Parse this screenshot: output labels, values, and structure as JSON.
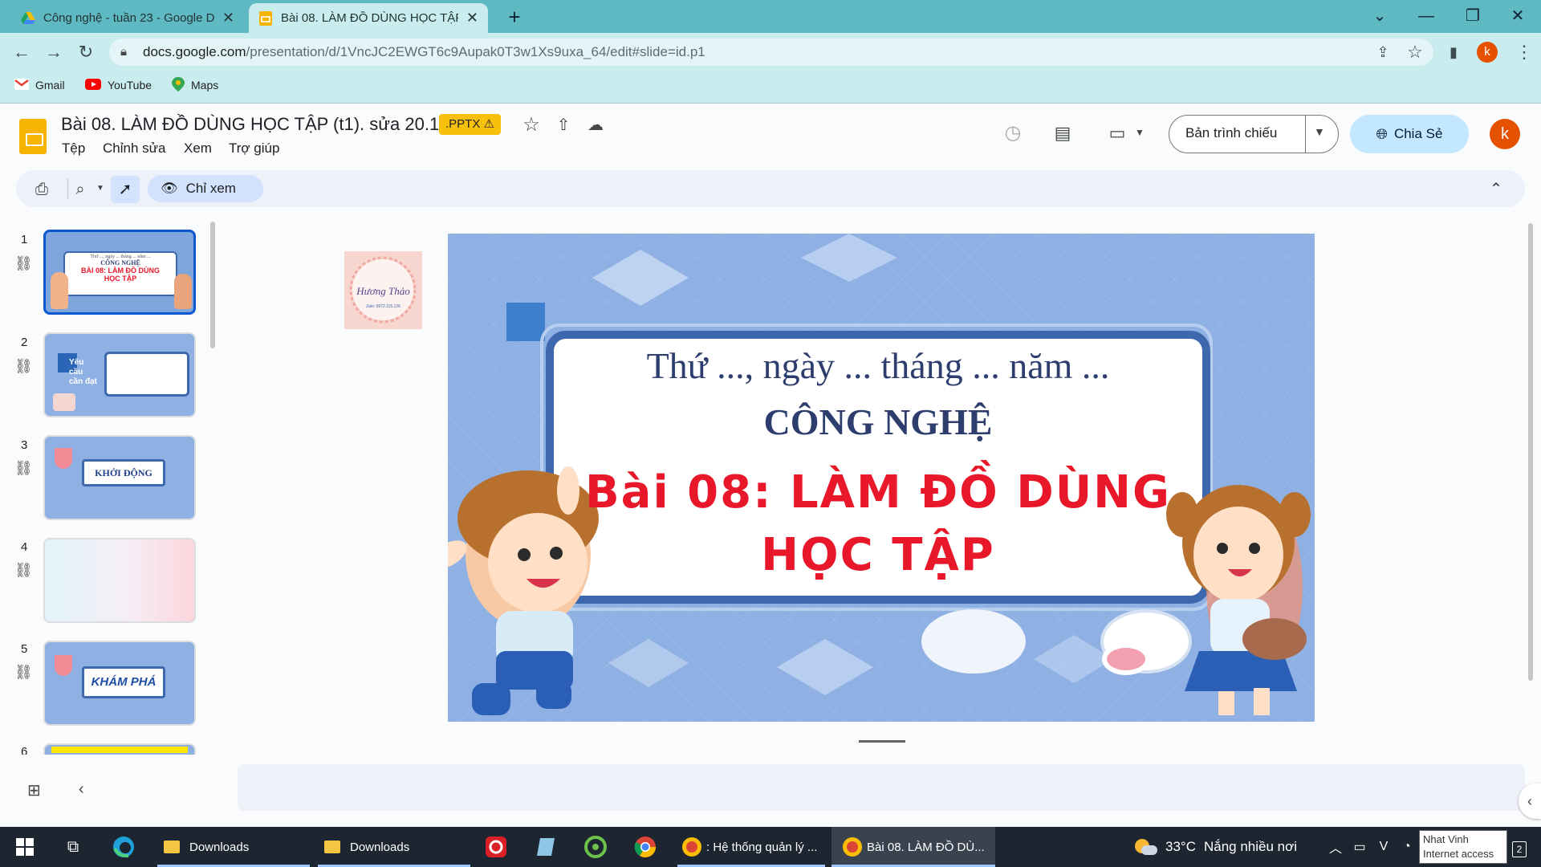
{
  "browser": {
    "tabs": [
      {
        "title": "Công nghệ - tuần 23 - Google Dr",
        "icon": "google-drive-icon",
        "active": false
      },
      {
        "title": "Bài 08. LÀM ĐỒ DÙNG HỌC TẬP",
        "icon": "google-slides-icon",
        "active": true
      }
    ],
    "url_host": "docs.google.com",
    "url_path": "/presentation/d/1VncJC2EWGT6c9Aupak0T3w1Xs9uxa_64/edit#slide=id.p1",
    "bookmarks": [
      {
        "label": "Gmail",
        "icon": "gmail-icon"
      },
      {
        "label": "YouTube",
        "icon": "youtube-icon"
      },
      {
        "label": "Maps",
        "icon": "maps-icon"
      }
    ],
    "profile_initial": "k"
  },
  "header": {
    "title": "Bài 08. LÀM ĐỒ DÙNG HỌC TẬP (t1). sửa 20.1",
    "badge": ".PPTX ⚠",
    "menus": [
      "Tệp",
      "Chỉnh sửa",
      "Xem",
      "Trợ giúp"
    ],
    "present_label": "Bản trình chiếu",
    "share_label": "Chia Sẻ",
    "avatar_initial": "k"
  },
  "toolbar": {
    "view_mode_label": "Chỉ xem"
  },
  "filmstrip": {
    "slides": [
      {
        "number": "1",
        "text": [
          "Thứ ..., ngày ... tháng ... năm ...",
          "CÔNG NGHỆ",
          "BÀI 08: LÀM ĐỒ DÙNG",
          "HỌC TẬP"
        ]
      },
      {
        "number": "2",
        "text": [
          "Yêu",
          "cầu",
          "cần đạt"
        ]
      },
      {
        "number": "3",
        "text": [
          "KHỞI ĐỘNG"
        ]
      },
      {
        "number": "4",
        "text": []
      },
      {
        "number": "5",
        "text": [
          "KHÁM PHÁ"
        ]
      },
      {
        "number": "6",
        "text": []
      }
    ]
  },
  "slide": {
    "date_line": "Thứ ..., ngày ... tháng ... năm ...",
    "subject": "CÔNG NGHỆ",
    "lesson_line1": "Bài 08: LÀM ĐỒ DÙNG",
    "lesson_line2": "HỌC TẬP",
    "stamp_name": "Hương Thảo",
    "stamp_sub": "Zalo: 0972.115.126",
    "colors": {
      "background": "#8fb0e3",
      "frame": "#3e68ad",
      "title": "#2d3e6e",
      "lesson": "#e8182a"
    }
  },
  "taskbar": {
    "items": [
      {
        "label": "Downloads",
        "icon": "folder-icon"
      },
      {
        "label": "Downloads",
        "icon": "folder-icon"
      },
      {
        "label": ": Hệ thống quản lý ...",
        "icon": "chrome-icon"
      },
      {
        "label": "Bài 08. LÀM ĐỒ DÙ...",
        "icon": "chrome-icon"
      }
    ],
    "weather_temp": "33°C",
    "weather_text": "Nắng nhiều nơi",
    "network_name": "Nhat Vinh",
    "network_status": "Internet access",
    "notification_count": "2"
  }
}
